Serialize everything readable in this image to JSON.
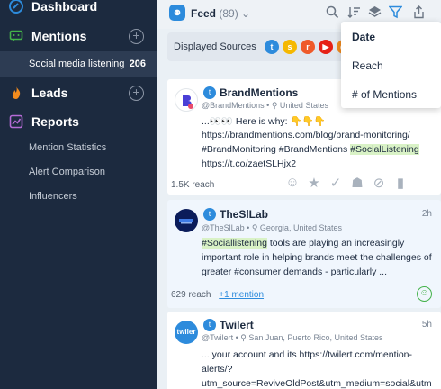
{
  "sidebar": {
    "items": [
      {
        "label": "Dashboard",
        "icon": "dashboard-icon"
      },
      {
        "label": "Mentions",
        "icon": "mentions-icon"
      },
      {
        "label": "Social media listening",
        "count": "206"
      },
      {
        "label": "Leads",
        "icon": "leads-icon"
      },
      {
        "label": "Reports",
        "icon": "reports-icon"
      },
      {
        "label": "Mention Statistics"
      },
      {
        "label": "Alert Comparison"
      },
      {
        "label": "Influencers"
      }
    ]
  },
  "toolbar": {
    "feed_label": "Feed",
    "feed_count": "(89)"
  },
  "sources": {
    "label": "Displayed Sources"
  },
  "dropdown": {
    "options": [
      "Date",
      "Reach",
      "# of Mentions"
    ]
  },
  "mentions": [
    {
      "author": "BrandMentions",
      "handle": "@BrandMentions",
      "location": "United States",
      "lines": [
        "...👀👀 Here is why: 👇👇👇",
        "https://brandmentions.com/blog/brand-monitoring/",
        "#BrandMonitoring #BrandMentions ",
        "https://t.co/zaetSLHjx2"
      ],
      "highlight": "#SocialListening",
      "reach": "1.5K reach"
    },
    {
      "author": "TheSlLab",
      "handle": "@TheSlLab",
      "location": "Georgia, United States",
      "time": "2h",
      "highlight": "#Sociallistening",
      "lines": [
        " tools are playing an increasingly",
        "important role in helping brands meet the challenges of",
        "greater #consumer demands - particularly ..."
      ],
      "reach": "629 reach",
      "extra": "+1 mention"
    },
    {
      "author": "Twilert",
      "handle": "@Twilert",
      "location": "San Juan, Puerto Rico, United States",
      "time": "5h",
      "lines": [
        "... your account and its https://twilert.com/mention-",
        "alerts/?",
        "utm_source=ReviveOldPost&utm_medium=social&utm"
      ],
      "avatar_text": "twiler"
    }
  ],
  "colors": {
    "sidebar_bg": "#1c2a3f",
    "accent_blue": "#2d8bdc",
    "highlight_green": "#d9f2c6",
    "positive_green": "#44b24a"
  }
}
